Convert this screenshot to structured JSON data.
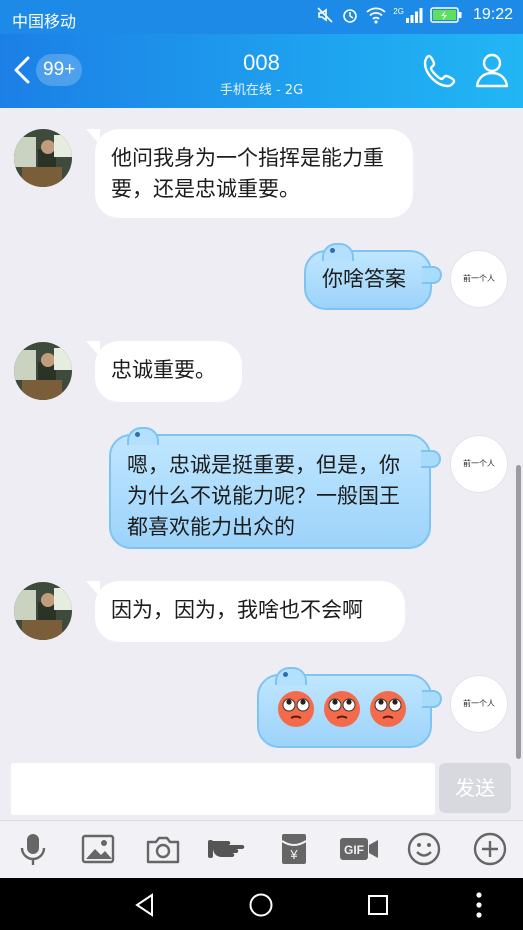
{
  "status_bar": {
    "carrier": "中国移动",
    "network": "2G",
    "time": "19:22"
  },
  "header": {
    "unread_badge": "99+",
    "title": "008",
    "subtitle": "手机在线 - 2G"
  },
  "my_avatar_label": "前一个人",
  "messages": [
    {
      "from": "friend",
      "text": "他问我身为一个指挥是能力重要，还是忠诚重要。"
    },
    {
      "from": "me",
      "text": "你啥答案"
    },
    {
      "from": "friend",
      "text": "忠诚重要。"
    },
    {
      "from": "me",
      "text": "嗯，忠诚是挺重要，但是，你为什么不说能力呢？一般国王都喜欢能力出众的"
    },
    {
      "from": "friend",
      "text": "因为，因为，我啥也不会啊"
    },
    {
      "from": "me",
      "emoji": [
        "rolling-eyes-emoji",
        "rolling-eyes-emoji",
        "rolling-eyes-emoji"
      ]
    }
  ],
  "composer": {
    "text_value": "",
    "send_label": "发送"
  },
  "toolbar": {
    "gif_label": "GIF",
    "icons": [
      "microphone-icon",
      "image-icon",
      "camera-icon",
      "hand-icon",
      "red-packet-icon",
      "gif-icon",
      "smiley-icon",
      "plus-icon"
    ]
  },
  "colors": {
    "header_start": "#1c7fe6",
    "header_end": "#22b6f4",
    "background": "#ededf3",
    "outgoing_bubble": "#a9dbfb",
    "outgoing_border": "#7ec4f2",
    "send_disabled": "#d8d9de"
  }
}
